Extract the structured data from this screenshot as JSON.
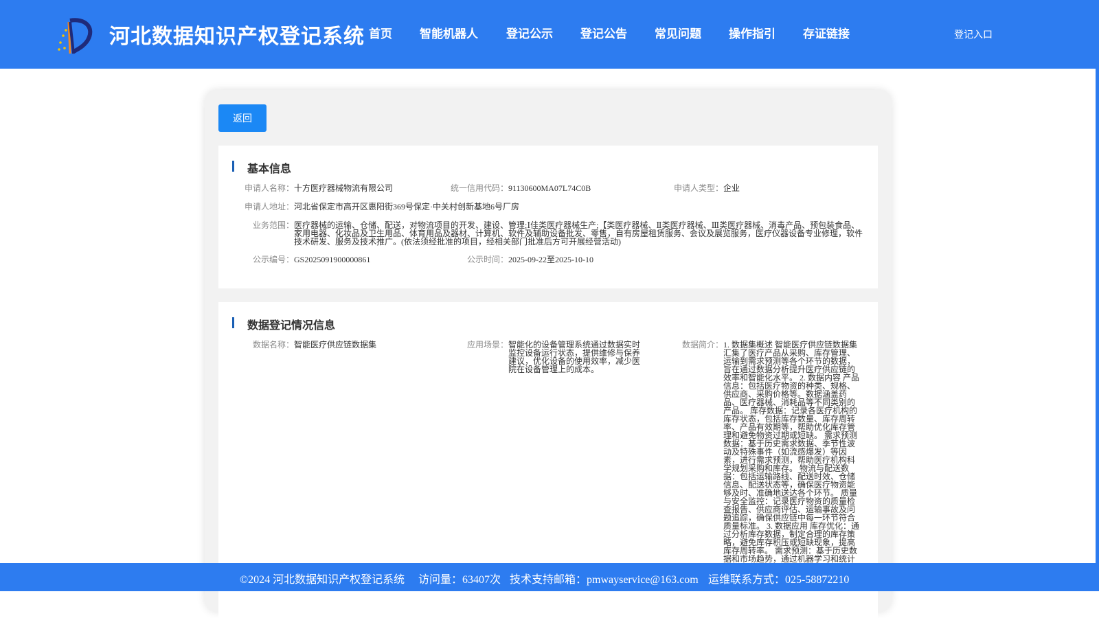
{
  "header": {
    "site_title": "河北数据知识产权登记系统",
    "nav": [
      "首页",
      "智能机器人",
      "登记公示",
      "登记公告",
      "常见问题",
      "操作指引",
      "存证链接"
    ],
    "login": "登记入口"
  },
  "actions": {
    "back": "返回"
  },
  "basic_info": {
    "title": "基本信息",
    "applicant_name_label": "申请人名称：",
    "applicant_name": "十方医疗器械物流有限公司",
    "credit_code_label": "统一信用代码：",
    "credit_code": "91130600MA07L74C0B",
    "applicant_type_label": "申请人类型：",
    "applicant_type": "企业",
    "address_label": "申请人地址：",
    "address": "河北省保定市高开区惠阳街369号保定·中关村创新基地6号厂房",
    "scope_label": "业务范围：",
    "scope": "医疗器械的运输、仓储、配送，对物流项目的开发、建设、管理;Ⅰ佳类医疗器械生产;【类医疗器械、Ⅱ类医疗器械、Ⅲ类医疗器械、消毒产品、预包装食品、家用电器、化妆品及卫生用品、体育用品及器材、计算机、软件及辅助设备批发、零售，自有房屋租赁服务、会议及展览服务，医疗仪器设备专业修理，软件技术研发、服务及技术推广。(依法须经批准的项目，经相关部门批准后方可开展经营活动)",
    "notice_no_label": "公示编号：",
    "notice_no": "GS2025091900000861",
    "notice_time_label": "公示时间：",
    "notice_time": "2025-09-22至2025-10-10"
  },
  "data_info": {
    "title": "数据登记情况信息",
    "data_name_label": "数据名称：",
    "data_name": "智能医疗供应链数据集",
    "scenario_label": "应用场景：",
    "scenario": "智能化的设备管理系统通过数据实时监控设备运行状态，提供维修与保养建议，优化设备的使用效率，减少医院在设备管理上的成本。",
    "intro_label": "数据简介：",
    "intro": "1. 数据集概述 智能医疗供应链数据集汇集了医疗产品从采购、库存管理、运输到需求预测等各个环节的数据，旨在通过数据分析提升医疗供应链的效率和智能化水平。 2. 数据内容 产品信息：包括医疗物资的种类、规格、供应商、采购价格等。数据涵盖药品、医疗器械、消耗品等不同类别的产品。 库存数据：记录各医疗机构的库存状态，包括库存数量、库存周转率、产品有效期等，帮助优化库存管理和避免物资过期或短缺。 需求预测数据：基于历史需求数据、季节性波动及特殊事件（如流感爆发）等因素，进行需求预测，帮助医疗机构科学规划采购和库存。 物流与配送数据：包括运输路线、配送时效、仓储信息、配送状态等，确保医疗物资能够及时、准确地送达各个环节。 质量与安全监控：记录医疗物资的质量检查报告、供应商评估、运输事故及问题追踪，确保供应链中每一环节符合质量标准。 3. 数据应用 库存优化：通过分析库存数据，制定合理的库存策略，避免库存积压或短缺现象，提高库存周转率。 需求预测：基于历史数据和市场趋势，通过机器学习和统计"
  },
  "footer": {
    "copyright": "©2024 河北数据知识产权登记系统",
    "visits": "访问量：63407次",
    "email": "技术支持邮箱：pmwayservice@163.com",
    "ops": "运维联系方式：025-58872210"
  },
  "colors": {
    "brand": "#2d7cf0",
    "button": "#1b88f5",
    "accent_bar": "#1a5fb4"
  },
  "icons": {
    "logo": "site-logo-icon"
  }
}
